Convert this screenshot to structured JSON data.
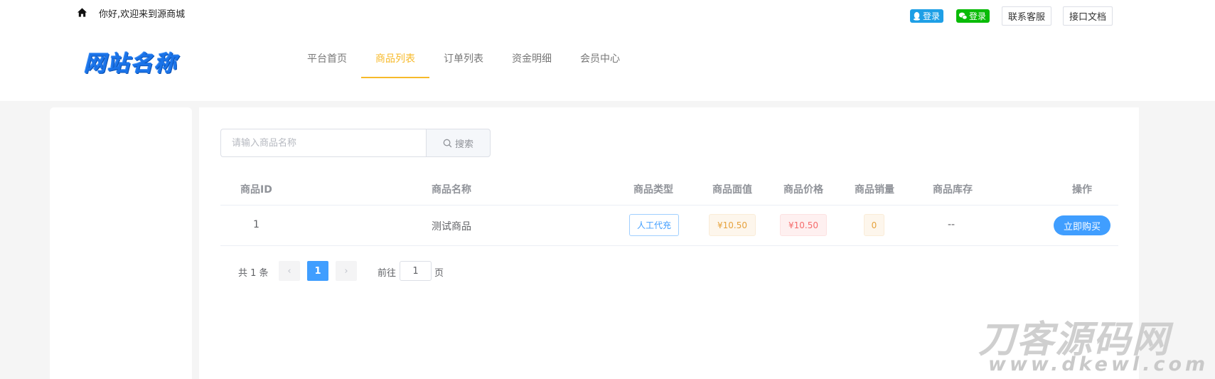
{
  "header": {
    "welcome": "你好,欢迎来到源商城",
    "qq_login": "登录",
    "wechat_login": "登录",
    "service_label": "联系客服",
    "docs_label": "接口文档",
    "logo_text": "网站名称"
  },
  "nav": {
    "items": [
      {
        "label": "平台首页",
        "active": false
      },
      {
        "label": "商品列表",
        "active": true
      },
      {
        "label": "订单列表",
        "active": false
      },
      {
        "label": "资金明细",
        "active": false
      },
      {
        "label": "会员中心",
        "active": false
      }
    ]
  },
  "search": {
    "placeholder": "请输入商品名称",
    "value": "",
    "button_label": "搜索"
  },
  "table": {
    "headers": [
      "商品ID",
      "商品名称",
      "商品类型",
      "商品面值",
      "商品价格",
      "商品销量",
      "商品库存",
      "操作"
    ],
    "rows": [
      {
        "id": "1",
        "name": "测试商品",
        "type": "人工代充",
        "face_value": "¥10.50",
        "price": "¥10.50",
        "sales": "0",
        "stock": "--",
        "action": "立即购买"
      }
    ]
  },
  "pagination": {
    "total": "共 1 条",
    "prev": "‹",
    "current": "1",
    "next": "›",
    "goto_label": "前往",
    "goto_value": "1",
    "page_suffix": "页"
  },
  "watermark": {
    "title": "刀客源码网",
    "url": "www.dkewl.com"
  },
  "colors": {
    "accent": "#f7ba2a",
    "primary": "#409eff",
    "qq": "#1e9fe6",
    "wechat": "#09bb07"
  }
}
